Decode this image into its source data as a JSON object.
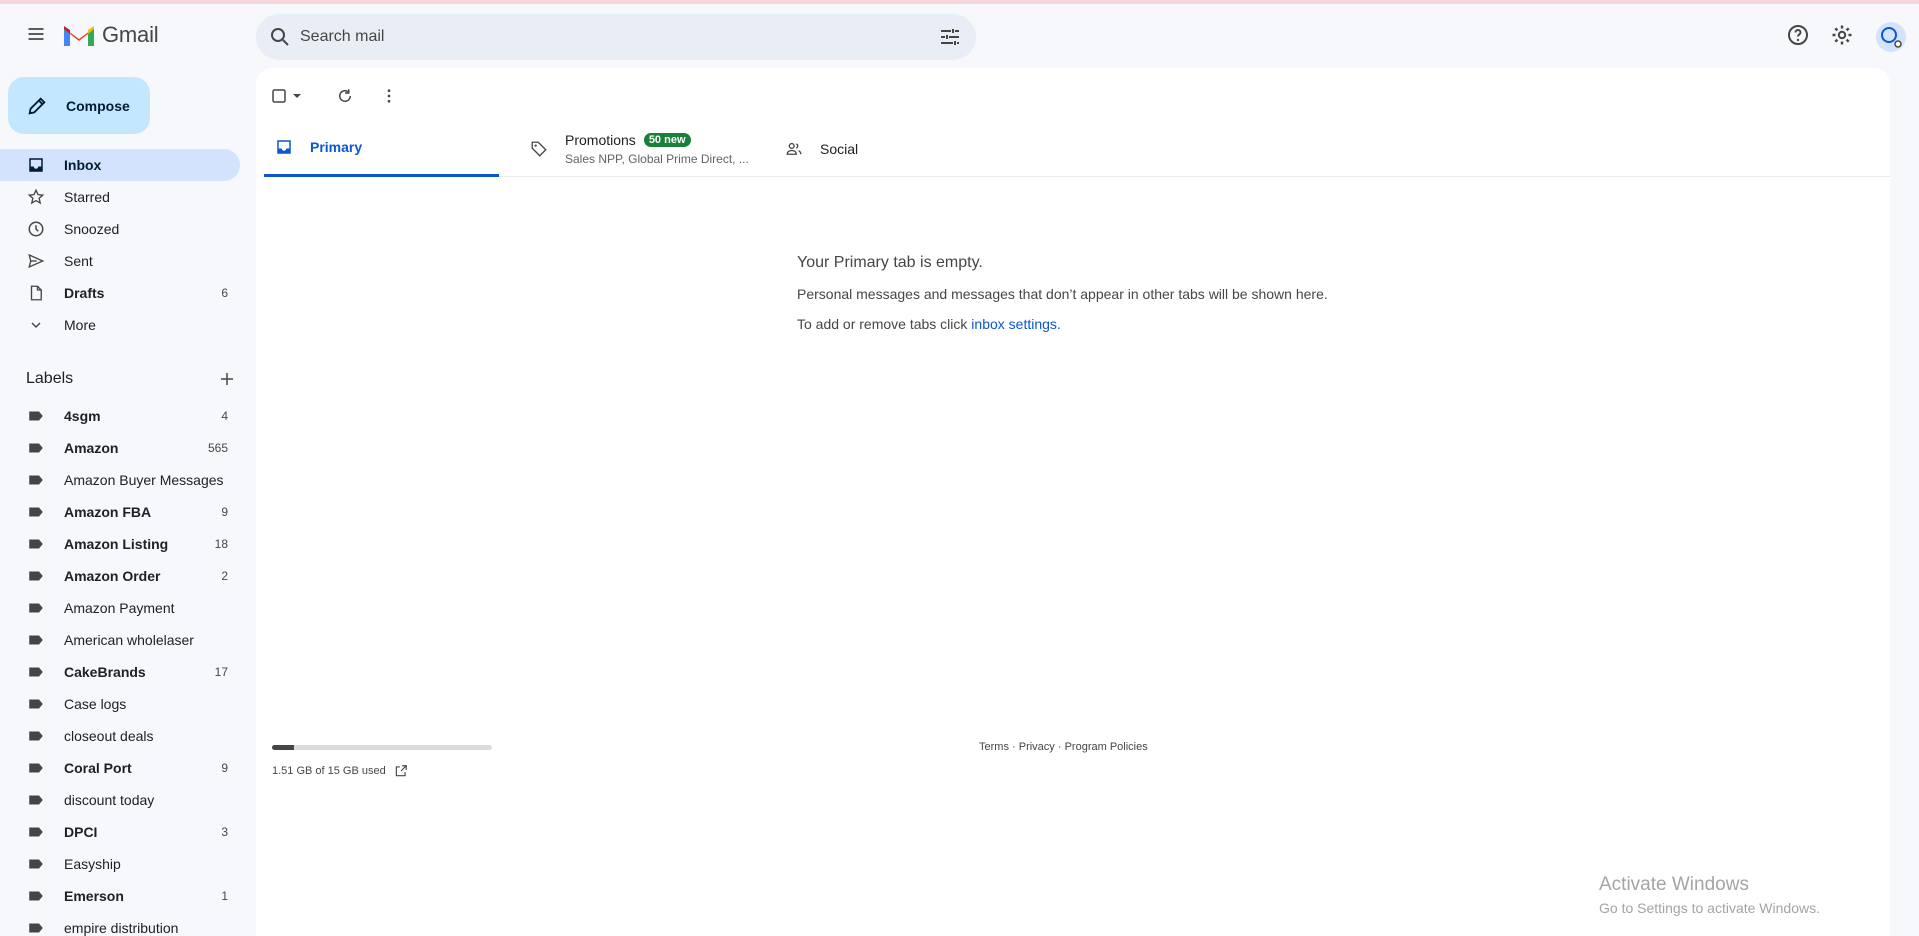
{
  "header": {
    "app_name": "Gmail",
    "search_placeholder": "Search mail",
    "icons": [
      "menu-icon",
      "gmail-logo",
      "search-icon",
      "tune-icon",
      "help-icon",
      "settings-icon",
      "avatar"
    ]
  },
  "sidebar": {
    "compose_label": "Compose",
    "nav": [
      {
        "label": "Inbox",
        "icon": "inbox-icon",
        "count": "",
        "active": true
      },
      {
        "label": "Starred",
        "icon": "star-icon",
        "count": ""
      },
      {
        "label": "Snoozed",
        "icon": "clock-icon",
        "count": ""
      },
      {
        "label": "Sent",
        "icon": "send-icon",
        "count": ""
      },
      {
        "label": "Drafts",
        "icon": "draft-icon",
        "count": "6"
      },
      {
        "label": "More",
        "icon": "chevron-down-icon",
        "count": ""
      }
    ],
    "labels_title": "Labels",
    "labels": [
      {
        "name": "4sgm",
        "count": "4"
      },
      {
        "name": "Amazon",
        "count": "565"
      },
      {
        "name": "Amazon Buyer Messages",
        "count": ""
      },
      {
        "name": "Amazon FBA",
        "count": "9"
      },
      {
        "name": "Amazon Listing",
        "count": "18"
      },
      {
        "name": "Amazon Order",
        "count": "2"
      },
      {
        "name": "Amazon Payment",
        "count": ""
      },
      {
        "name": "American wholelaser",
        "count": ""
      },
      {
        "name": "CakeBrands",
        "count": "17"
      },
      {
        "name": "Case logs",
        "count": ""
      },
      {
        "name": "closeout deals",
        "count": ""
      },
      {
        "name": "Coral Port",
        "count": "9"
      },
      {
        "name": "discount today",
        "count": ""
      },
      {
        "name": "DPCI",
        "count": "3"
      },
      {
        "name": "Easyship",
        "count": ""
      },
      {
        "name": "Emerson",
        "count": "1"
      },
      {
        "name": "empire distribution",
        "count": ""
      }
    ]
  },
  "tabs": {
    "primary": "Primary",
    "promotions": "Promotions",
    "promotions_badge": "50 new",
    "promotions_senders": "Sales NPP, Global Prime Direct, ...",
    "social": "Social"
  },
  "empty_state": {
    "title": "Your Primary tab is empty.",
    "line1": "Personal messages and messages that don’t appear in other tabs will be shown here.",
    "line2_prefix": "To add or remove tabs click ",
    "line2_link": "inbox settings."
  },
  "storage": {
    "used_text": "1.51 GB of 15 GB used",
    "fraction": 0.1
  },
  "footer": {
    "terms": "Terms",
    "privacy": "Privacy",
    "policies": "Program Policies",
    "sep": " · "
  },
  "watermark": {
    "title": "Activate Windows",
    "subtitle": "Go to Settings to activate Windows."
  }
}
